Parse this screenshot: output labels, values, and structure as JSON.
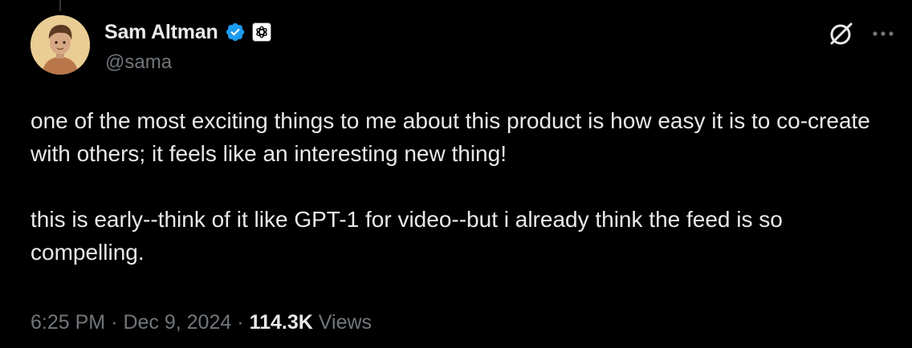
{
  "author": {
    "display_name": "Sam Altman",
    "handle": "@sama",
    "verified_color": "#1d9bf0"
  },
  "tweet": {
    "paragraphs": [
      "one of the most exciting things to me about this product is how easy it is to co-create with others; it feels like an interesting new thing!",
      "this is early--think of it like GPT-1 for video--but i already think the feed is so compelling."
    ]
  },
  "meta": {
    "time": "6:25 PM",
    "separator": "·",
    "date": "Dec 9, 2024",
    "views_count": "114.3K",
    "views_label": "Views"
  },
  "icons": {
    "verified": "verified-badge-icon",
    "affiliate": "openai-logo-icon",
    "grok": "grok-icon",
    "more": "more-horizontal-icon"
  },
  "colors": {
    "background": "#000000",
    "primary_text": "#e7e9ea",
    "secondary_text": "#71767b",
    "accent": "#1d9bf0"
  }
}
